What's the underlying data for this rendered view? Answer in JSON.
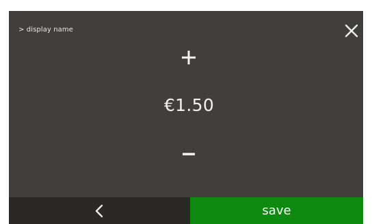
{
  "header": {
    "breadcrumb": "> display name",
    "close_icon": "close-icon"
  },
  "editor": {
    "increment_icon": "plus-icon",
    "value": "€1.50",
    "decrement_icon": "minus-icon"
  },
  "footer": {
    "back_icon": "chevron-left-icon",
    "save_label": "save"
  },
  "colors": {
    "screen_background": "#403f3b",
    "back_bar": "#2a2927",
    "save_accent": "#0e8a10",
    "text": "#f2f2f0"
  }
}
